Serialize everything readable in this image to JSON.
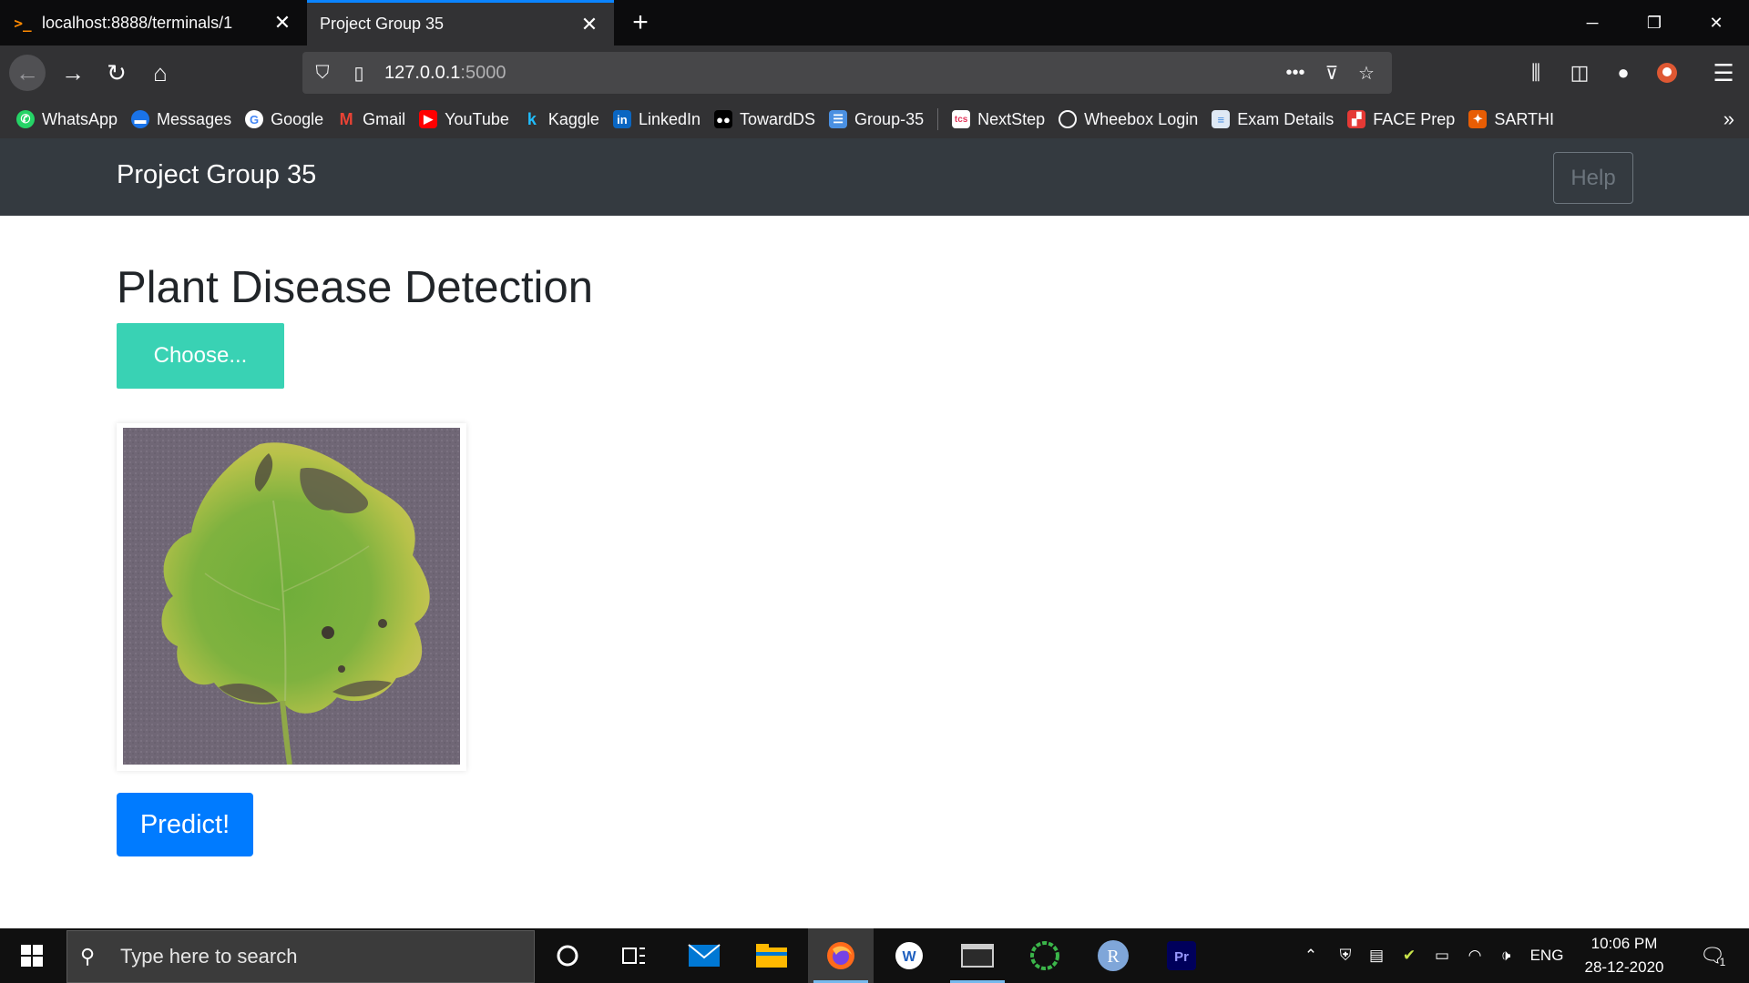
{
  "browser": {
    "tabs": [
      {
        "title": "localhost:8888/terminals/1",
        "favicon": "terminal-prompt-icon"
      },
      {
        "title": "Project Group 35",
        "active": true
      }
    ],
    "url": {
      "host": "127.0.0.1",
      "port": ":5000"
    },
    "bookmarks": [
      {
        "label": "WhatsApp",
        "icon": "whatsapp-icon",
        "color": "#25d366"
      },
      {
        "label": "Messages",
        "icon": "messages-icon",
        "color": "#1a73e8"
      },
      {
        "label": "Google",
        "icon": "google-icon",
        "color": "#ffffff"
      },
      {
        "label": "Gmail",
        "icon": "gmail-icon",
        "color": "#ea4335"
      },
      {
        "label": "YouTube",
        "icon": "youtube-icon",
        "color": "#ff0000"
      },
      {
        "label": "Kaggle",
        "icon": "kaggle-icon",
        "color": "#20beff"
      },
      {
        "label": "LinkedIn",
        "icon": "linkedin-icon",
        "color": "#0a66c2"
      },
      {
        "label": "TowardDS",
        "icon": "medium-icon",
        "color": "#000000"
      },
      {
        "label": "Group-35",
        "icon": "chat-icon",
        "color": "#4a90e2"
      },
      {
        "label": "NextStep",
        "icon": "tcs-icon",
        "color": "#e2365b"
      },
      {
        "label": "Wheebox Login",
        "icon": "globe-icon",
        "color": "#323234"
      },
      {
        "label": "Exam Details",
        "icon": "document-icon",
        "color": "#4a90e2"
      },
      {
        "label": "FACE Prep",
        "icon": "faceprep-icon",
        "color": "#e53935"
      },
      {
        "label": "SARTHI",
        "icon": "sarthi-icon",
        "color": "#e85d04"
      }
    ]
  },
  "site": {
    "brand": "Project Group 35",
    "help_label": "Help",
    "heading": "Plant Disease Detection",
    "choose_label": "Choose...",
    "predict_label": "Predict!"
  },
  "taskbar": {
    "search_placeholder": "Type here to search",
    "language": "ENG",
    "time": "10:06 PM",
    "date": "28-12-2020",
    "notification_count": "1"
  },
  "colors": {
    "accent_teal": "#39d2b4",
    "primary_blue": "#007bff",
    "navbar_dark": "#343a40"
  }
}
